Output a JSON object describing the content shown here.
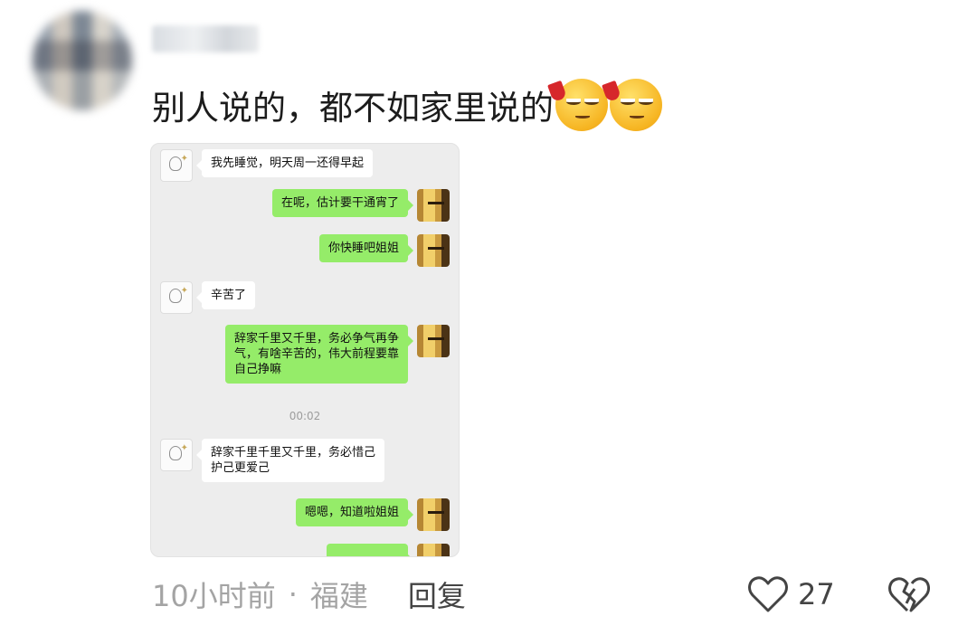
{
  "comment": {
    "text": "别人说的，都不如家里说的",
    "emoji_icon": "smirk-with-wine-emoji",
    "emoji_count": 2
  },
  "chat": {
    "messages": [
      {
        "side": "left",
        "text": "我先睡觉，明天周一还得早起"
      },
      {
        "side": "right",
        "text": "在呢，估计要干通宵了"
      },
      {
        "side": "right",
        "text": "你快睡吧姐姐"
      },
      {
        "side": "left",
        "text": "辛苦了"
      },
      {
        "side": "right",
        "text": "辞家千里又千里，务必争气再争\n气，有啥辛苦的，伟大前程要靠\n自己挣嘛"
      },
      {
        "side": "left",
        "text": "辞家千里千里又千里，务必惜己\n护己更爱己"
      },
      {
        "side": "right",
        "text": "嗯嗯，知道啦姐姐"
      }
    ],
    "timestamp": "00:02"
  },
  "footer": {
    "time": "10小时前",
    "separator": "·",
    "location": "福建",
    "reply_label": "回复",
    "like_count": "27"
  },
  "colors": {
    "green_bubble": "#95ec69",
    "chat_background": "#ededed",
    "meta_text": "#a4a4a4"
  }
}
